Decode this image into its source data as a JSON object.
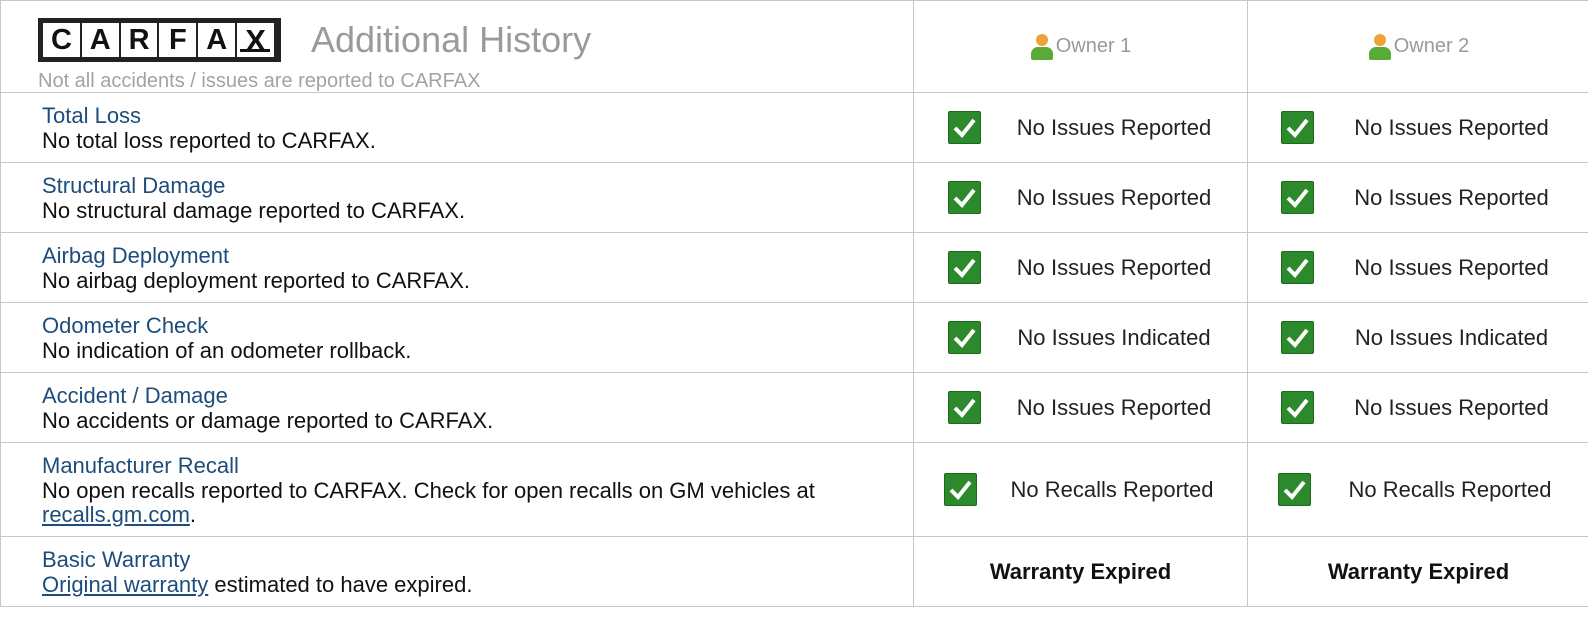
{
  "header": {
    "logo_letters": [
      "C",
      "A",
      "R",
      "F",
      "A",
      "X"
    ],
    "title": "Additional History",
    "subtitle": "Not all accidents / issues are reported to CARFAX",
    "owners": [
      "Owner 1",
      "Owner 2"
    ]
  },
  "rows": [
    {
      "title": "Total Loss",
      "desc": "No total loss reported to CARFAX.",
      "owner1": "No Issues Reported",
      "owner2": "No Issues Reported"
    },
    {
      "title": "Structural Damage",
      "desc": "No structural damage reported to CARFAX.",
      "owner1": "No Issues Reported",
      "owner2": "No Issues Reported"
    },
    {
      "title": "Airbag Deployment",
      "desc": "No airbag deployment reported to CARFAX.",
      "owner1": "No Issues Reported",
      "owner2": "No Issues Reported"
    },
    {
      "title": "Odometer Check",
      "desc": "No indication of an odometer rollback.",
      "owner1": "No Issues Indicated",
      "owner2": "No Issues Indicated"
    },
    {
      "title": "Accident / Damage",
      "desc": "No accidents or damage reported to CARFAX.",
      "owner1": "No Issues Reported",
      "owner2": "No Issues Reported"
    },
    {
      "title": "Manufacturer Recall",
      "desc": "No open recalls reported to CARFAX. Check for open recalls on GM vehicles at",
      "link": "recalls.gm.com",
      "desc_end": ".",
      "owner1": "No Recalls Reported",
      "owner2": "No Recalls Reported"
    },
    {
      "title": "Basic Warranty",
      "link": "Original warranty",
      "desc": "estimated to have expired.",
      "owner1": "Warranty Expired",
      "owner2": "Warranty Expired"
    }
  ],
  "icons": {
    "status": "check-icon",
    "owner": "person-icon"
  },
  "colors": {
    "check_green": "#2c8a2c",
    "link_blue": "#1e4d7b",
    "header_gray": "#9a9a9a"
  }
}
